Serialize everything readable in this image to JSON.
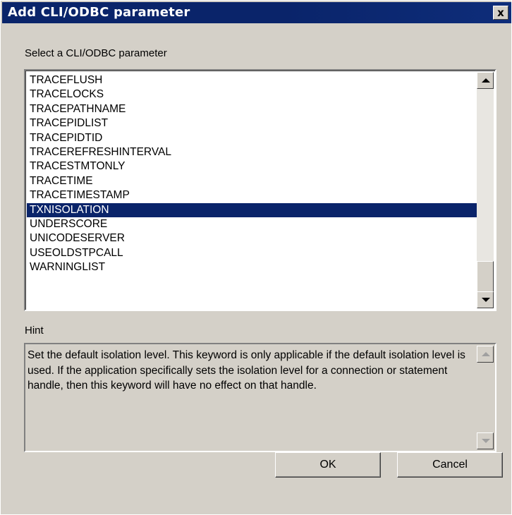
{
  "window": {
    "title": "Add CLI/ODBC parameter",
    "close_label": "x"
  },
  "list": {
    "label": "Select a CLI/ODBC parameter",
    "items": [
      "TRACEFLUSH",
      "TRACELOCKS",
      "TRACEPATHNAME",
      "TRACEPIDLIST",
      "TRACEPIDTID",
      "TRACEREFRESHINTERVAL",
      "TRACESTMTONLY",
      "TRACETIME",
      "TRACETIMESTAMP",
      "TXNISOLATION",
      "UNDERSCORE",
      "UNICODESERVER",
      "USEOLDSTPCALL",
      "WARNINGLIST"
    ],
    "selected": "TXNISOLATION"
  },
  "hint": {
    "label": "Hint",
    "text": "Set the default isolation level. This keyword is only applicable if the default isolation level is used.  If the application specifically sets the isolation level for a connection or statement handle, then this keyword will have no effect on that handle."
  },
  "buttons": {
    "ok": "OK",
    "cancel": "Cancel"
  },
  "colors": {
    "title_bar": "#0a246a",
    "selection": "#0a246a",
    "dialog_bg": "#d4d0c8"
  }
}
